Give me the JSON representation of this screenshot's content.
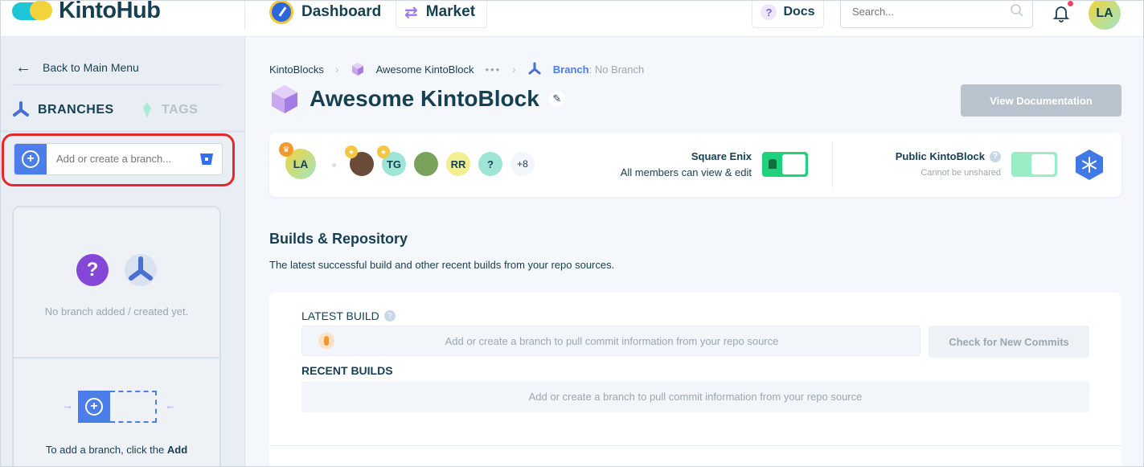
{
  "brand": {
    "name": "KintoHub"
  },
  "nav": {
    "dashboard_label": "Dashboard",
    "market_label": "Market",
    "docs_label": "Docs",
    "search_placeholder": "Search...",
    "user_initials": "LA"
  },
  "sidebar": {
    "back_label": "Back to Main Menu",
    "tab_branches": "BRANCHES",
    "tab_tags": "TAGS",
    "branch_input_placeholder": "Add or create a branch...",
    "empty_message": "No branch added / created yet.",
    "hint_prefix": "To add a branch, click the",
    "hint_bold": "Add"
  },
  "breadcrumb": {
    "root": "KintoBlocks",
    "block": "Awesome KintoBlock",
    "ellipsis": "•••",
    "branch_label": "Branch",
    "branch_value": ": No Branch"
  },
  "page": {
    "title": "Awesome KintoBlock",
    "view_docs_label": "View Documentation"
  },
  "members": {
    "owner_initials": "LA",
    "list": [
      {
        "initials": "",
        "kind": "photo"
      },
      {
        "initials": "TG",
        "kind": "initials"
      },
      {
        "initials": "",
        "kind": "photo"
      },
      {
        "initials": "RR",
        "kind": "initials"
      },
      {
        "initials": "?",
        "kind": "initials"
      }
    ],
    "more_count": "+8",
    "org_name": "Square Enix",
    "org_permission": "All members can view & edit",
    "public_label": "Public KintoBlock",
    "public_sub": "Cannot be unshared"
  },
  "builds": {
    "section_title": "Builds & Repository",
    "section_subtitle": "The latest successful build and other recent builds from your repo sources.",
    "latest_label": "LATEST BUILD",
    "latest_message": "Add or create a branch to pull commit information from your repo source",
    "check_button": "Check for New Commits",
    "recent_label": "RECENT BUILDS",
    "recent_message": "Add or create a branch to pull commit information from your repo source"
  },
  "colors": {
    "accent": "#4b7ee8",
    "highlight_ring": "#e8272b",
    "toggle_on": "#1ed17a",
    "text_dark": "#173f52"
  }
}
